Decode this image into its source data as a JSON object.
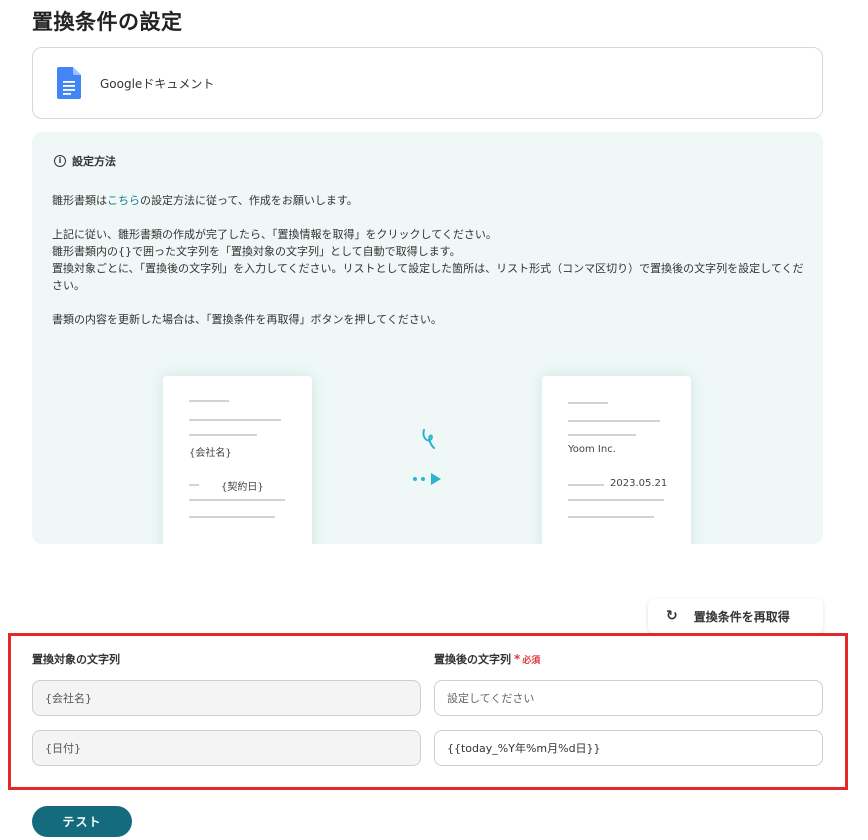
{
  "page": {
    "title": "置換条件の設定"
  },
  "app": {
    "name": "Googleドキュメント",
    "icon": "google-docs-icon"
  },
  "info": {
    "heading": "設定方法",
    "line1_pre": "雛形書類は",
    "line1_link": "こちら",
    "line1_post": "の設定方法に従って、作成をお願いします。",
    "line2": "上記に従い、雛形書類の作成が完了したら、「置換情報を取得」をクリックしてください。",
    "line3": "雛形書類内の{}で囲った文字列を「置換対象の文字列」として自動で取得します。",
    "line4": "置換対象ごとに、「置換後の文字列」を入力してください。リストとして設定した箇所は、リスト形式（コンマ区切り）で置換後の文字列を設定してください。",
    "line5": "書類の内容を更新した場合は、「置換条件を再取得」ボタンを押してください。"
  },
  "illustration": {
    "left_label1": "{会社名}",
    "left_label2": "{契約日}",
    "right_label1": "Yoom Inc.",
    "right_label2": "2023.05.21",
    "accent_color": "#2bb5cc"
  },
  "refetch": {
    "label": "置換条件を再取得",
    "icon": "refresh-icon"
  },
  "form": {
    "source_label": "置換対象の文字列",
    "target_label": "置換後の文字列",
    "required_label": "必須",
    "rows": [
      {
        "source": "{会社名}",
        "target_value": "",
        "target_placeholder": "設定してください"
      },
      {
        "source": "{日付}",
        "target_value": "{{today_%Y年%m月%d日}}",
        "target_placeholder": ""
      }
    ]
  },
  "actions": {
    "test_label": "テスト"
  },
  "colors": {
    "highlight_border": "#e22a2a",
    "primary": "#136b7d",
    "panel_bg": "#eff8f7"
  }
}
